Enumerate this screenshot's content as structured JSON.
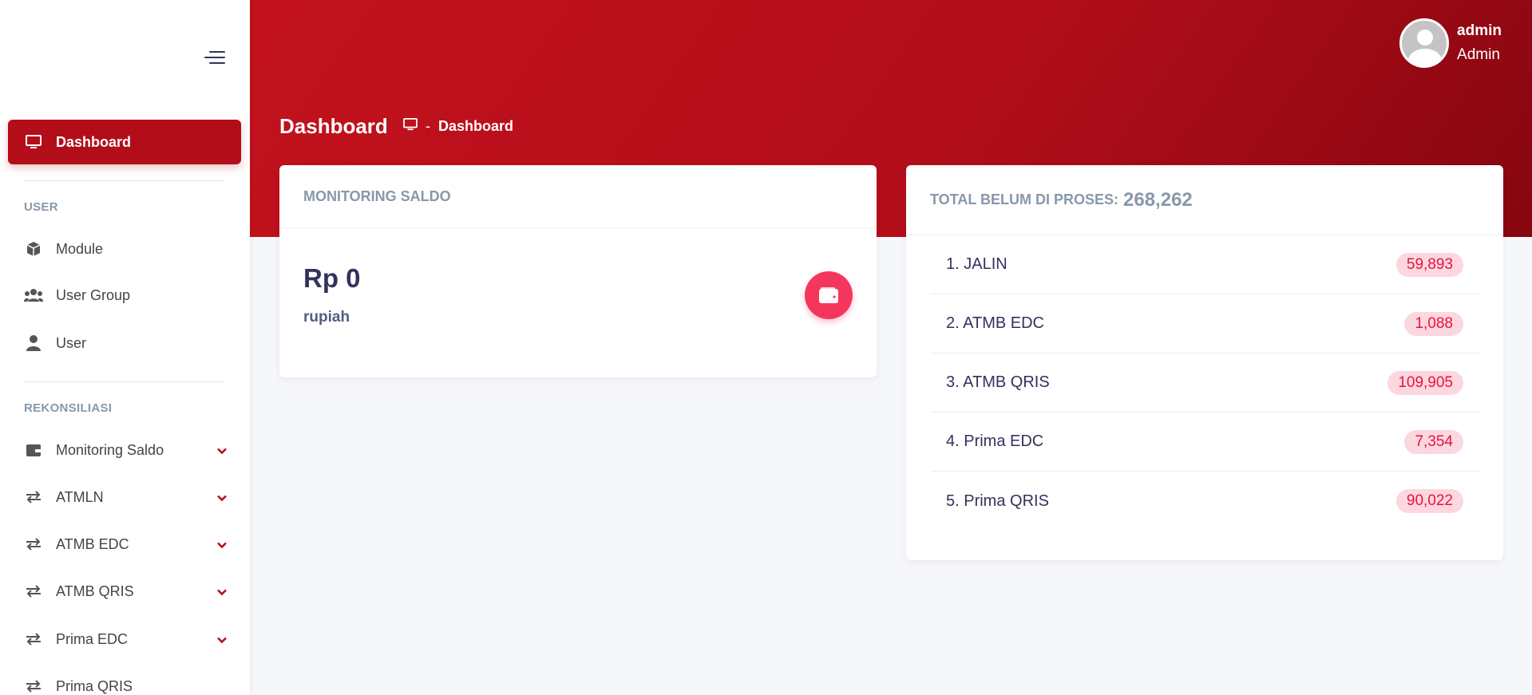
{
  "sidebar": {
    "dashboard": "Dashboard",
    "section_user": "USER",
    "module": "Module",
    "user_group": "User Group",
    "user": "User",
    "section_rekon": "REKONSILIASI",
    "monitoring_saldo": "Monitoring Saldo",
    "atmln": "ATMLN",
    "atmb_edc": "ATMB EDC",
    "atmb_qris": "ATMB QRIS",
    "prima_edc": "Prima EDC",
    "prima_qris": "Prima QRIS"
  },
  "header": {
    "username": "admin",
    "role": "Admin",
    "page_title": "Dashboard",
    "breadcrumb_sep": "-",
    "breadcrumb_item": "Dashboard"
  },
  "monitoring": {
    "title": "MONITORING SALDO",
    "amount": "Rp 0",
    "unit": "rupiah"
  },
  "pending": {
    "title": "TOTAL BELUM DI PROSES:",
    "total": "268,262",
    "items": [
      {
        "label": "1. JALIN",
        "value": "59,893"
      },
      {
        "label": "2. ATMB EDC",
        "value": "1,088"
      },
      {
        "label": "3. ATMB QRIS",
        "value": "109,905"
      },
      {
        "label": "4. Prima EDC",
        "value": "7,354"
      },
      {
        "label": "5. Prima QRIS",
        "value": "90,022"
      }
    ]
  },
  "colors": {
    "brand": "#b30d1a",
    "accent": "#f5365c",
    "badge_bg": "#fcd7df"
  }
}
